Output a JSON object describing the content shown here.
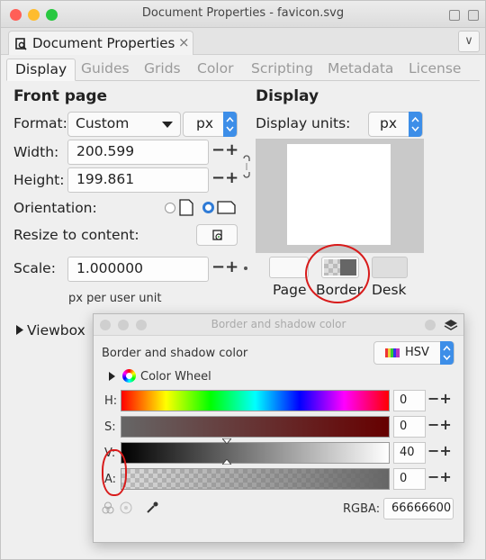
{
  "window": {
    "title": "Document Properties - favicon.svg"
  },
  "dock": {
    "tab_label": "Document Properties",
    "close_glyph": "×",
    "collapse_glyph": "∨"
  },
  "tabs": [
    "Display",
    "Guides",
    "Grids",
    "Color",
    "Scripting",
    "Metadata",
    "License"
  ],
  "front_page": {
    "title": "Front page",
    "format_label": "Format:",
    "format_value": "Custom",
    "format_unit": "px",
    "width_label": "Width:",
    "width_value": "200.599",
    "height_label": "Height:",
    "height_value": "199.861",
    "orientation_label": "Orientation:",
    "resize_label": "Resize to content:",
    "scale_label": "Scale:",
    "scale_value": "1.000000",
    "scale_note": "px per user unit",
    "viewbox_label": "Viewbox"
  },
  "display": {
    "title": "Display",
    "units_label": "Display units:",
    "units_value": "px",
    "swatch_labels": [
      "Page",
      "Border",
      "Desk"
    ]
  },
  "color_dialog": {
    "title": "Border and shadow color",
    "heading": "Border and shadow color",
    "mode": "HSV",
    "wheel_label": "Color Wheel",
    "rows": [
      {
        "label": "H:",
        "value": "0"
      },
      {
        "label": "S:",
        "value": "0"
      },
      {
        "label": "V:",
        "value": "40"
      },
      {
        "label": "A:",
        "value": "0"
      }
    ],
    "rgba_label": "RGBA:",
    "rgba_value": "66666600"
  },
  "colors": {
    "accent": "#3d8ee8",
    "annotation": "#d81b1b",
    "border_color": "#666666"
  }
}
